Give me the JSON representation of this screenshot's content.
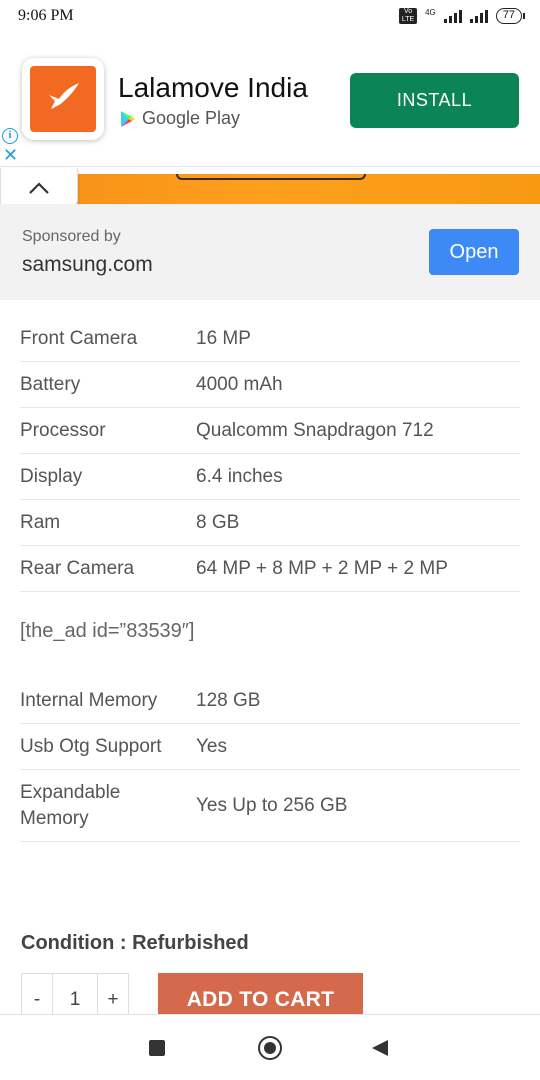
{
  "status_bar": {
    "time": "9:06 PM",
    "volte": "Vo LTE",
    "network": "4G",
    "battery": "77"
  },
  "app_ad": {
    "app_name": "Lalamove India",
    "store": "Google Play",
    "install_label": "INSTALL",
    "info_glyph": "i",
    "close_glyph": "✕",
    "icon": "hummingbird-logo",
    "brand_color": "#f26a21",
    "install_color": "#0b8457"
  },
  "collapse": {
    "glyph": "chevron-up"
  },
  "sponsored": {
    "by_label": "Sponsored by",
    "domain": "samsung.com",
    "open_label": "Open",
    "open_color": "#3d8af7"
  },
  "specs_a": [
    {
      "label": "Front Camera",
      "value": "16 MP"
    },
    {
      "label": "Battery",
      "value": "4000 mAh"
    },
    {
      "label": "Processor",
      "value": "Qualcomm Snapdragon 712"
    },
    {
      "label": "Display",
      "value": "6.4 inches"
    },
    {
      "label": "Ram",
      "value": "8 GB"
    },
    {
      "label": "Rear Camera",
      "value": "64 MP + 8 MP + 2 MP + 2 MP"
    }
  ],
  "ad_shortcode": "[the_ad id=”83539″]",
  "specs_b": [
    {
      "label": "Internal Memory",
      "value": "128 GB"
    },
    {
      "label": "Usb Otg Support",
      "value": "Yes"
    },
    {
      "label": "Expandable Memory",
      "value": "Yes Up to 256 GB"
    }
  ],
  "product": {
    "condition": "Condition  : Refurbished",
    "qty_minus": "-",
    "qty_value": "1",
    "qty_plus": "+",
    "add_to_cart": "ADD TO CART",
    "cart_color": "#d4694b"
  },
  "nav": {
    "recents": "square-icon",
    "home": "circle-icon",
    "back": "triangle-back-icon"
  }
}
